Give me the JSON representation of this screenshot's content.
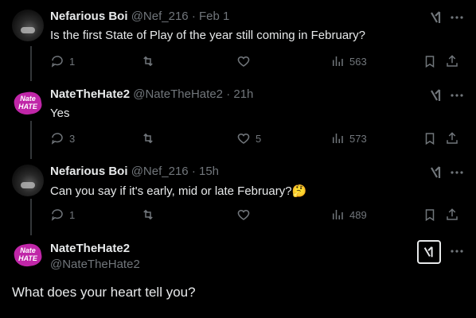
{
  "tweets": [
    {
      "name": "Nefarious Boi",
      "handle": "@Nef_216",
      "time": "· Feb 1",
      "text": "Is the first State of Play of the year still coming in February?",
      "replies": "1",
      "retweets": "",
      "likes": "",
      "views": "563"
    },
    {
      "name": "NateTheHate2",
      "handle": "@NateTheHate2",
      "time": "· 21h",
      "text": "Yes",
      "replies": "3",
      "retweets": "",
      "likes": "5",
      "views": "573"
    },
    {
      "name": "Nefarious Boi",
      "handle": "@Nef_216",
      "time": "· 15h",
      "text": "Can you say if it's early, mid or late February?🤔",
      "replies": "1",
      "retweets": "",
      "likes": "",
      "views": "489"
    }
  ],
  "main_tweet": {
    "name": "NateTheHate2",
    "handle": "@NateTheHate2",
    "text": "What does your heart tell you?"
  },
  "avatar_text": "Nate HATE",
  "icons": {
    "reply": "reply-icon",
    "retweet": "retweet-icon",
    "like": "heart-icon",
    "views": "views-icon",
    "bookmark": "bookmark-icon",
    "share": "share-icon",
    "grok": "grok-icon",
    "more": "more-icon"
  },
  "colors": {
    "background": "#000000",
    "text": "#e7e9ea",
    "muted": "#71767b",
    "avatar_brand": "#c026a8"
  }
}
